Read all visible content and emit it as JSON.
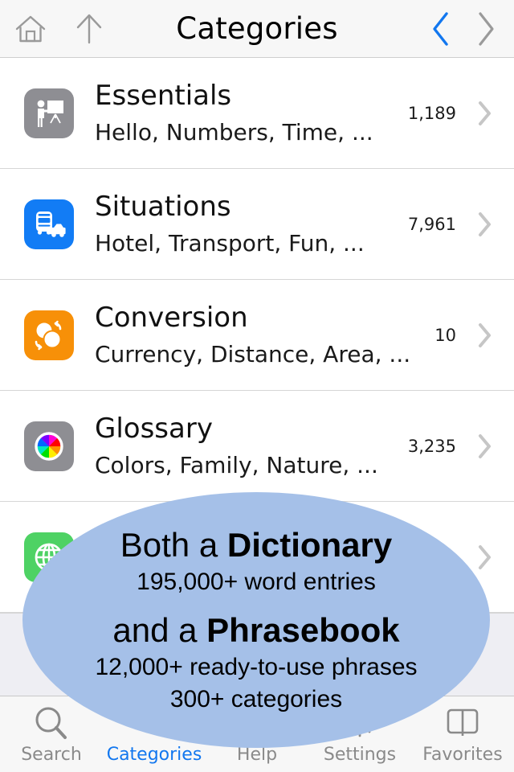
{
  "header": {
    "title": "Categories",
    "home_icon": "home-icon",
    "up_icon": "up-arrow-icon",
    "back_icon": "chevron-left-icon",
    "forward_icon": "chevron-right-icon",
    "back_color": "#1277ef",
    "forward_color": "#9a9a9a"
  },
  "list": {
    "rows": [
      {
        "title": "Essentials",
        "subtitle": "Hello, Numbers, Time, ...",
        "count": "1,189",
        "icon": "presenter-board-icon",
        "icon_bg": "#8e8e93"
      },
      {
        "title": "Situations",
        "subtitle": "Hotel, Transport, Fun, ...",
        "count": "7,961",
        "icon": "bus-car-icon",
        "icon_bg": "#127cf5"
      },
      {
        "title": "Conversion",
        "subtitle": "Currency, Distance, Area, ...",
        "count": "10",
        "icon": "convert-circles-icon",
        "icon_bg": "#f79008"
      },
      {
        "title": "Glossary",
        "subtitle": "Colors, Family, Nature, ...",
        "count": "3,235",
        "icon": "color-wheel-icon",
        "icon_bg": "#8e8e93"
      },
      {
        "title": "",
        "subtitle": "",
        "count": "",
        "icon": "globe-icon",
        "icon_bg": "#4ed264"
      }
    ]
  },
  "promo": {
    "line1_prefix": "Both a ",
    "line1_strong": "Dictionary",
    "line2": "195,000+ word entries",
    "line3_prefix": "and a ",
    "line3_strong": "Phrasebook",
    "line4": "12,000+ ready-to-use phrases",
    "line5": "300+ categories",
    "bg_color": "#a5c0e8"
  },
  "tabbar": {
    "active_color": "#1277ef",
    "inactive_color": "#8a8a8a",
    "tabs": [
      {
        "label": "Search",
        "icon": "magnifier-icon",
        "active": false
      },
      {
        "label": "Categories",
        "icon": "list-icon",
        "active": true
      },
      {
        "label": "Help",
        "icon": "question-icon",
        "active": false
      },
      {
        "label": "Settings",
        "icon": "gear-icon",
        "active": false
      },
      {
        "label": "Favorites",
        "icon": "open-book-icon",
        "active": false
      }
    ]
  }
}
